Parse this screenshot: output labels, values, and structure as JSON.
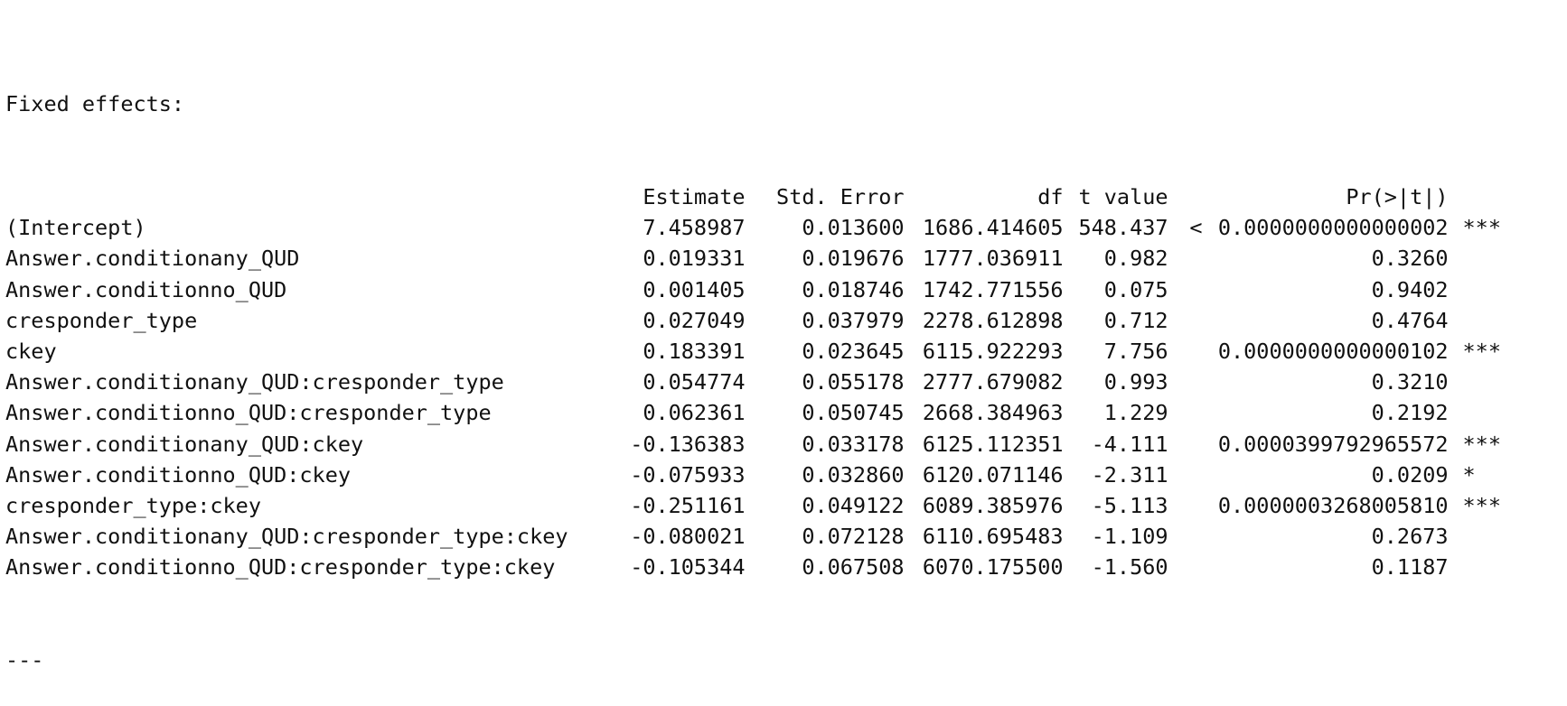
{
  "heading": "Fixed effects:",
  "columns": {
    "name": "",
    "estimate": "Estimate",
    "std_error": "Std. Error",
    "df": "df",
    "t_value": "t value",
    "lt": "",
    "p_value": "Pr(>|t|)",
    "signif": ""
  },
  "rows": [
    {
      "name": "(Intercept)",
      "estimate": "7.458987",
      "std_error": "0.013600",
      "df": "1686.414605",
      "t_value": "548.437",
      "lt": "<",
      "p_value": "0.0000000000000002",
      "signif": "***"
    },
    {
      "name": "Answer.conditionany_QUD",
      "estimate": "0.019331",
      "std_error": "0.019676",
      "df": "1777.036911",
      "t_value": "0.982",
      "lt": "",
      "p_value": "0.3260",
      "signif": ""
    },
    {
      "name": "Answer.conditionno_QUD",
      "estimate": "0.001405",
      "std_error": "0.018746",
      "df": "1742.771556",
      "t_value": "0.075",
      "lt": "",
      "p_value": "0.9402",
      "signif": ""
    },
    {
      "name": "cresponder_type",
      "estimate": "0.027049",
      "std_error": "0.037979",
      "df": "2278.612898",
      "t_value": "0.712",
      "lt": "",
      "p_value": "0.4764",
      "signif": ""
    },
    {
      "name": "ckey",
      "estimate": "0.183391",
      "std_error": "0.023645",
      "df": "6115.922293",
      "t_value": "7.756",
      "lt": "",
      "p_value": "0.0000000000000102",
      "signif": "***"
    },
    {
      "name": "Answer.conditionany_QUD:cresponder_type",
      "estimate": "0.054774",
      "std_error": "0.055178",
      "df": "2777.679082",
      "t_value": "0.993",
      "lt": "",
      "p_value": "0.3210",
      "signif": ""
    },
    {
      "name": "Answer.conditionno_QUD:cresponder_type",
      "estimate": "0.062361",
      "std_error": "0.050745",
      "df": "2668.384963",
      "t_value": "1.229",
      "lt": "",
      "p_value": "0.2192",
      "signif": ""
    },
    {
      "name": "Answer.conditionany_QUD:ckey",
      "estimate": "-0.136383",
      "std_error": "0.033178",
      "df": "6125.112351",
      "t_value": "-4.111",
      "lt": "",
      "p_value": "0.0000399792965572",
      "signif": "***"
    },
    {
      "name": "Answer.conditionno_QUD:ckey",
      "estimate": "-0.075933",
      "std_error": "0.032860",
      "df": "6120.071146",
      "t_value": "-2.311",
      "lt": "",
      "p_value": "0.0209",
      "signif": "*"
    },
    {
      "name": "cresponder_type:ckey",
      "estimate": "-0.251161",
      "std_error": "0.049122",
      "df": "6089.385976",
      "t_value": "-5.113",
      "lt": "",
      "p_value": "0.0000003268005810",
      "signif": "***"
    },
    {
      "name": "Answer.conditionany_QUD:cresponder_type:ckey",
      "estimate": "-0.080021",
      "std_error": "0.072128",
      "df": "6110.695483",
      "t_value": "-1.109",
      "lt": "",
      "p_value": "0.2673",
      "signif": ""
    },
    {
      "name": "Answer.conditionno_QUD:cresponder_type:ckey",
      "estimate": "-0.105344",
      "std_error": "0.067508",
      "df": "6070.175500",
      "t_value": "-1.560",
      "lt": "",
      "p_value": "0.1187",
      "signif": ""
    }
  ],
  "separator": "---"
}
